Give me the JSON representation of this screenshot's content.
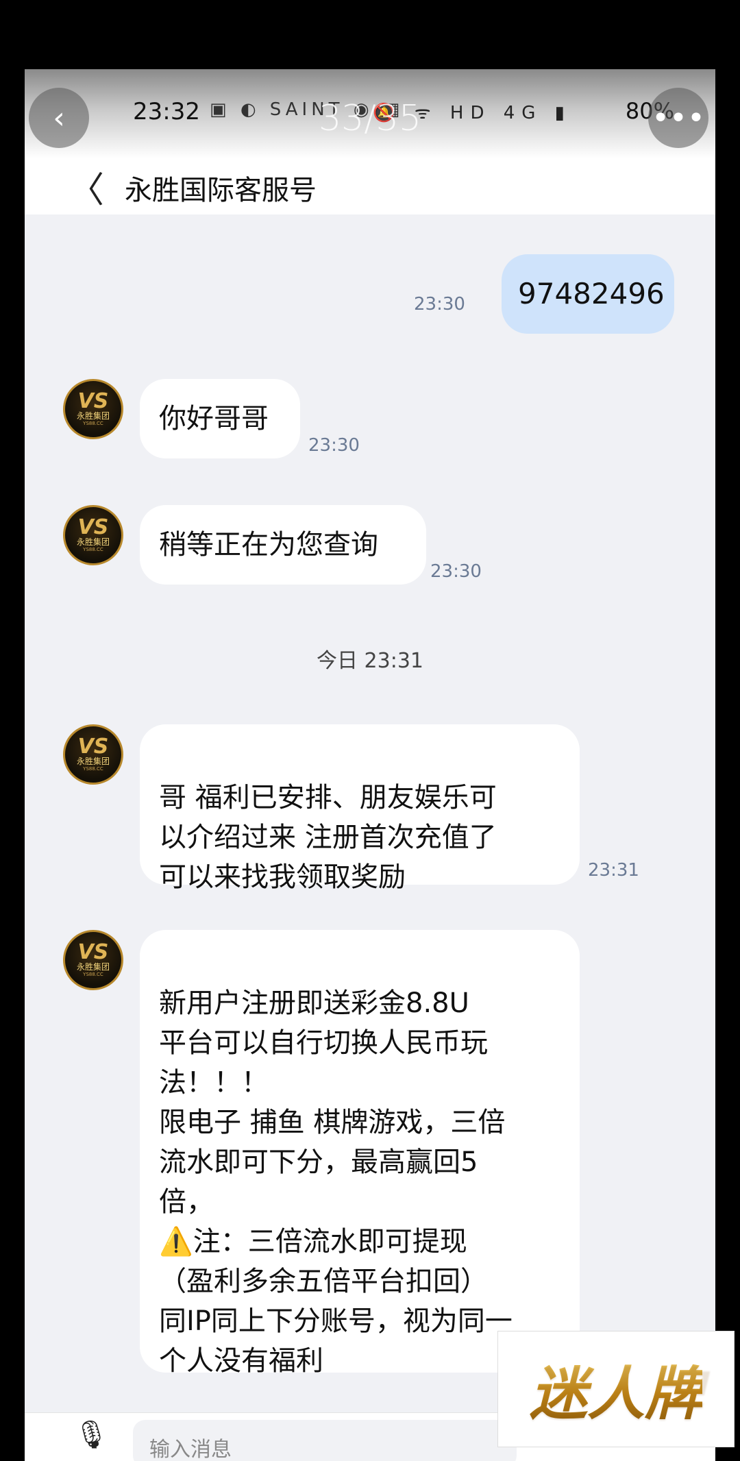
{
  "status_bar": {
    "time": "23:32",
    "battery": "80%",
    "app_icons": "▣ ◐ SAINT ◉ ▦",
    "system_icons": "🔕 ᯤ HD 4G ▮"
  },
  "viewer": {
    "counter": "33/35",
    "back_glyph": "‹",
    "more_glyph": "•••"
  },
  "header": {
    "back_glyph": "〈",
    "title": "永胜国际客服号"
  },
  "avatar": {
    "logo_text": "VS",
    "group_name": "永胜集团",
    "domain": "YS88.CC"
  },
  "messages": [
    {
      "side": "me",
      "text": "97482496",
      "time": "23:30"
    },
    {
      "side": "them",
      "text": "你好哥哥",
      "time": "23:30"
    },
    {
      "side": "them",
      "text": "稍等正在为您查询",
      "time": "23:30"
    },
    {
      "side": "them",
      "text": "哥 福利已安排、朋友娱乐可\n以介绍过来  注册首次充值了\n可以来找我领取奖励",
      "time": "23:31"
    },
    {
      "side": "them",
      "text": "新用户注册即送彩金8.8U\n平台可以自行切换人民币玩\n法！！！\n限电子 捕鱼 棋牌游戏，三倍\n流水即可下分，最高赢回5\n倍，\n⚠️注：三倍流水即可提现\n（盈利多余五倍平台扣回）\n同IP同上下分账号，视为同一\n个人没有福利",
      "time": ""
    }
  ],
  "divider": "今日 23:31",
  "input": {
    "placeholder": "输入消息"
  },
  "watermark": "迷人牌",
  "colors": {
    "my_bubble": "#cfe3fb",
    "their_bubble": "#ffffff",
    "chat_bg": "#f0f1f5",
    "read_check": "#3a7be0"
  }
}
